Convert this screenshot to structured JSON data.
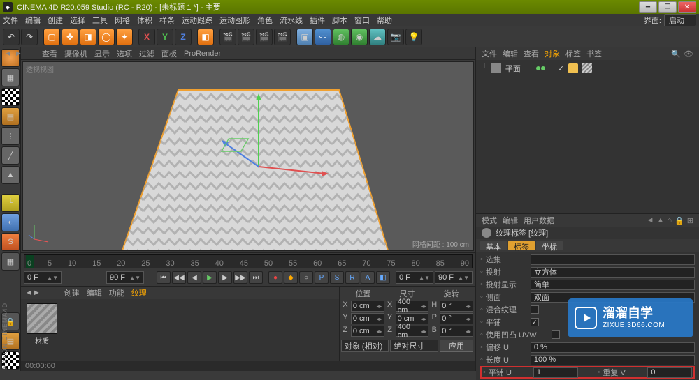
{
  "title": "CINEMA 4D R20.059 Studio (RC - R20) - [未标题 1 *] - 主要",
  "menubar": {
    "items": [
      "文件",
      "编辑",
      "创建",
      "选择",
      "工具",
      "网格",
      "体积",
      "样条",
      "运动跟踪",
      "运动图形",
      "角色",
      "流水线",
      "插件",
      "脚本",
      "窗口",
      "帮助"
    ],
    "right_label": "界面:",
    "layout": "启动"
  },
  "viewtabs": [
    "查看",
    "摄像机",
    "显示",
    "选项",
    "过滤",
    "面板",
    "ProRender"
  ],
  "viewport": {
    "label": "透视视图",
    "info": "网格间距 : 100 cm"
  },
  "ruler_ticks": [
    "0",
    "5",
    "10",
    "15",
    "20",
    "25",
    "30",
    "35",
    "40",
    "45",
    "50",
    "55",
    "60",
    "65",
    "70",
    "75",
    "80",
    "85",
    "90"
  ],
  "playback": {
    "start": "0 F",
    "end": "90 F",
    "cur": "0 F",
    "dur": "90 F"
  },
  "mat_tabs": [
    "创建",
    "编辑",
    "功能",
    "纹理"
  ],
  "material_name": "材质",
  "coords": {
    "headers": [
      "位置",
      "尺寸",
      "旋转"
    ],
    "rows": [
      {
        "axis": "X",
        "pos": "0 cm",
        "size": "400 cm",
        "rotL": "H",
        "rot": "0 °"
      },
      {
        "axis": "Y",
        "pos": "0 cm",
        "size": "0 cm",
        "rotL": "P",
        "rot": "0 °"
      },
      {
        "axis": "Z",
        "pos": "0 cm",
        "size": "400 cm",
        "rotL": "B",
        "rot": "0 °"
      }
    ],
    "mode1": "对象 (相对)",
    "mode2": "绝对尺寸",
    "apply": "应用"
  },
  "objpanel": {
    "tabs": [
      "文件",
      "编辑",
      "查看",
      "对象",
      "标签",
      "书签"
    ],
    "item": "平面"
  },
  "attr": {
    "tabs": [
      "模式",
      "编辑",
      "用户数据"
    ],
    "header": "纹理标签 [纹理]",
    "subtabs": [
      "基本",
      "标签",
      "坐标"
    ],
    "rows": {
      "selection": "选集",
      "projection_lbl": "投射",
      "projection_val": "立方体",
      "display_lbl": "投射显示",
      "display_val": "简单",
      "side_lbl": "侧面",
      "side_val": "双面",
      "mix_lbl": "混合纹理",
      "tile_lbl": "平铺",
      "uvw_lbl": "使用凹凸 UVW",
      "offsetU_lbl": "偏移 U",
      "offsetU_val": "0 %",
      "lengthU_lbl": "长度 U",
      "lengthU_val": "100 %",
      "tileU_lbl": "平铺 U",
      "tileU_val": "1",
      "repeatV_lbl": "重复 V",
      "repeatV_val": "0"
    }
  },
  "watermark": {
    "brand": "溜溜自学",
    "url": "ZIXUE.3D66.COM"
  },
  "vbrand": "MAXON CINEMA4D",
  "status": "00:00:00"
}
